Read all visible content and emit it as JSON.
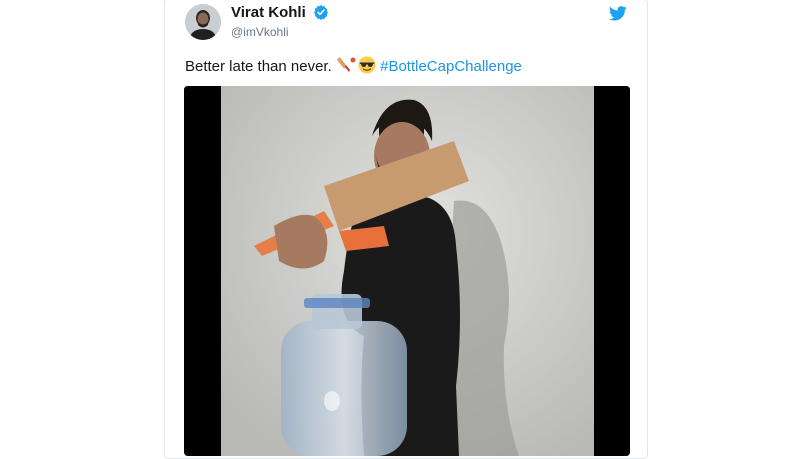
{
  "tweet": {
    "display_name": "Virat Kohli",
    "handle": "@imVkohli",
    "text": "Better late than never.",
    "hashtag": "#BottleCapChallenge",
    "icons": {
      "verified": "verified-badge-icon",
      "twitter": "twitter-bird-icon",
      "emoji_1": "cricket-bat-emoji",
      "emoji_2": "sunglasses-emoji"
    }
  },
  "colors": {
    "link": "#1b95e0",
    "twitter_blue": "#1da1f2",
    "text": "#14171a",
    "secondary_text": "#657786",
    "border": "#e1e8ed"
  }
}
